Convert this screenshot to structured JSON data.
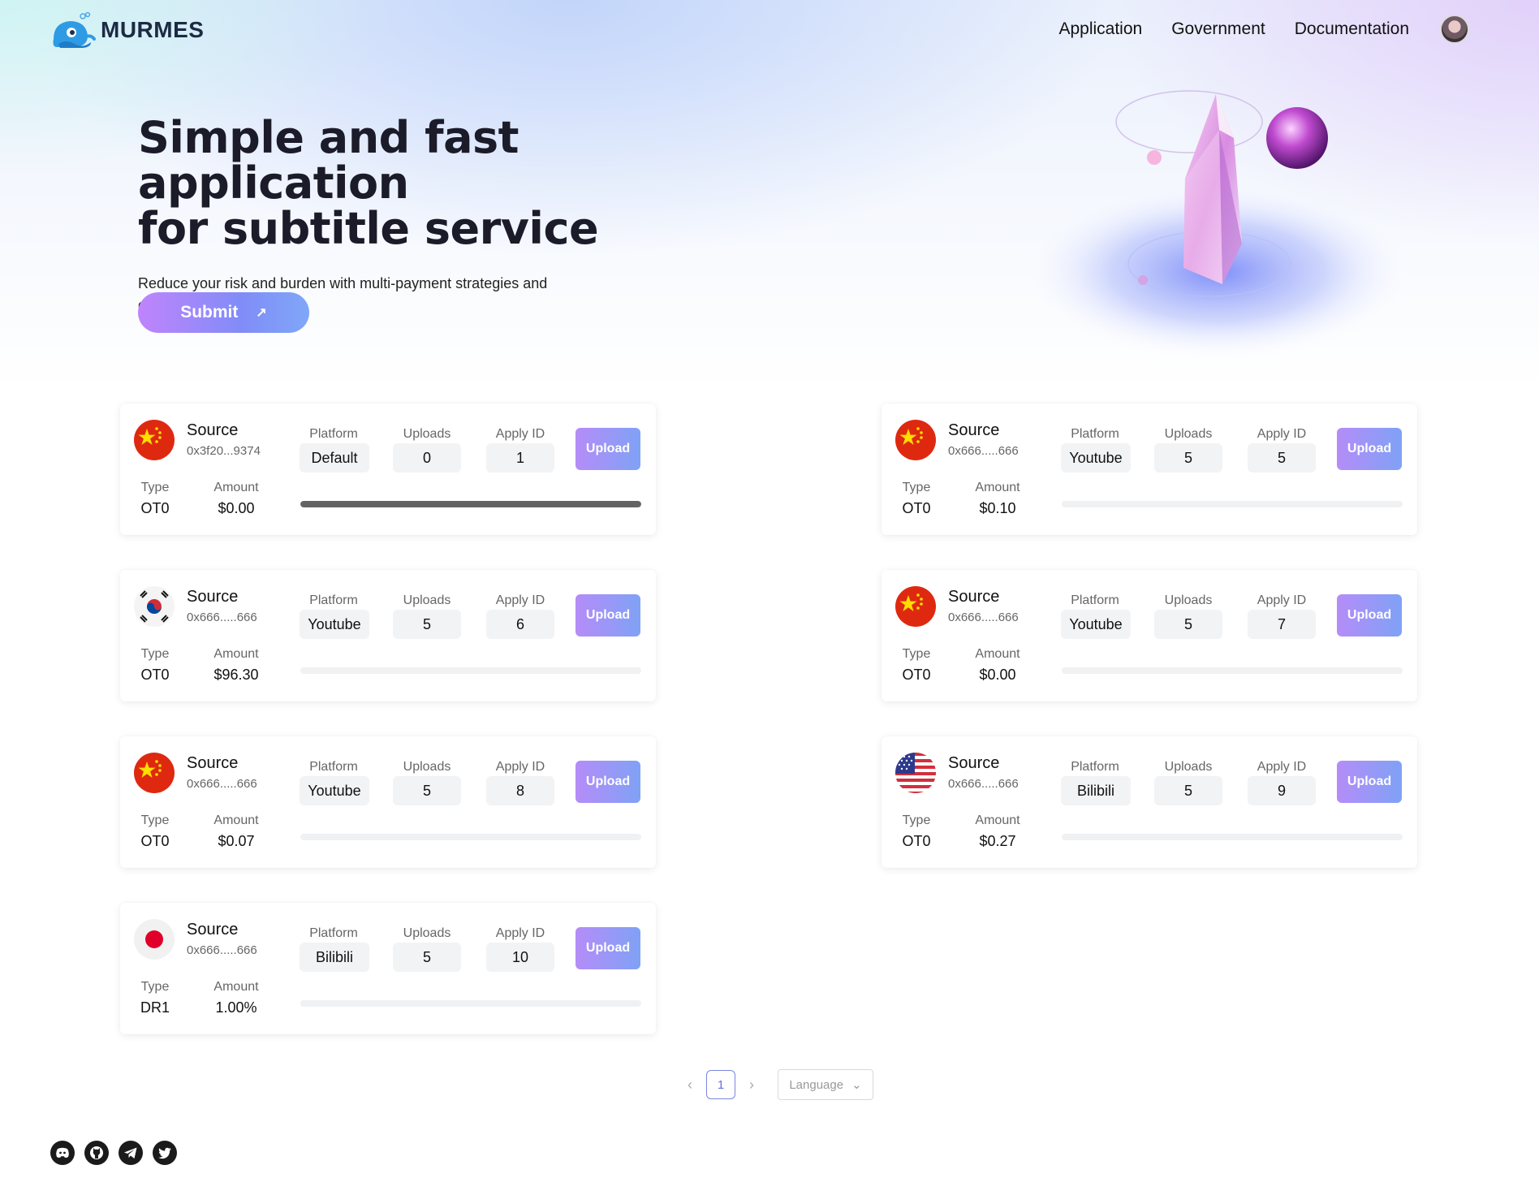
{
  "header": {
    "brand": "MURMES",
    "nav": [
      "Application",
      "Government",
      "Documentation"
    ]
  },
  "hero": {
    "title_line1": "Simple and fast application",
    "title_line2": "for subtitle service",
    "subtitle": "Reduce your risk and burden with multi-payment strategies and decentralized audit.",
    "submit_label": "Submit",
    "submit_icon": "arrow-up-right-icon"
  },
  "labels": {
    "source": "Source",
    "platform": "Platform",
    "uploads": "Uploads",
    "apply_id": "Apply ID",
    "type": "Type",
    "amount": "Amount",
    "upload_btn": "Upload"
  },
  "cards": [
    {
      "flag": "china",
      "address": "0x3f20...9374",
      "platform": "Default",
      "uploads": "0",
      "apply_id": "1",
      "type": "OT0",
      "amount": "$0.00",
      "progress": 1.0
    },
    {
      "flag": "china",
      "address": "0x666.....666",
      "platform": "Youtube",
      "uploads": "5",
      "apply_id": "5",
      "type": "OT0",
      "amount": "$0.10",
      "progress": 0
    },
    {
      "flag": "korea",
      "address": "0x666.....666",
      "platform": "Youtube",
      "uploads": "5",
      "apply_id": "6",
      "type": "OT0",
      "amount": "$96.30",
      "progress": 0
    },
    {
      "flag": "china",
      "address": "0x666.....666",
      "platform": "Youtube",
      "uploads": "5",
      "apply_id": "7",
      "type": "OT0",
      "amount": "$0.00",
      "progress": 0
    },
    {
      "flag": "china",
      "address": "0x666.....666",
      "platform": "Youtube",
      "uploads": "5",
      "apply_id": "8",
      "type": "OT0",
      "amount": "$0.07",
      "progress": 0
    },
    {
      "flag": "usa",
      "address": "0x666.....666",
      "platform": "Bilibili",
      "uploads": "5",
      "apply_id": "9",
      "type": "OT0",
      "amount": "$0.27",
      "progress": 0
    },
    {
      "flag": "japan",
      "address": "0x666.....666",
      "platform": "Bilibili",
      "uploads": "5",
      "apply_id": "10",
      "type": "DR1",
      "amount": "1.00%",
      "progress": 0
    }
  ],
  "pagination": {
    "current": "1",
    "language_placeholder": "Language"
  },
  "footer": {
    "socials": [
      "discord-icon",
      "github-icon",
      "telegram-icon",
      "twitter-icon"
    ]
  },
  "colors": {
    "accent_start": "#c084fc",
    "accent_end": "#7fa7f8",
    "progress_fill": "#636363"
  }
}
